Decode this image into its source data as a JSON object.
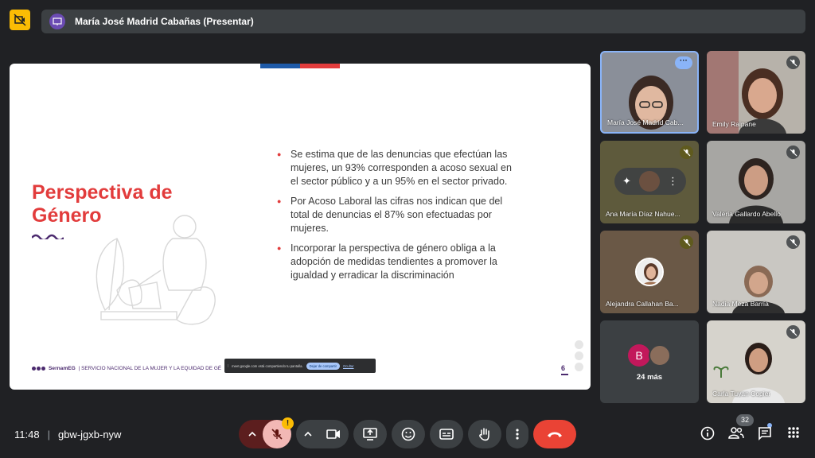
{
  "presenter": {
    "name": "María José Madrid Cabañas (Presentar)"
  },
  "slide": {
    "title": "Perspectiva de Género",
    "bullets": [
      "Se estima que de las denuncias que efectúan las mujeres, un 93% corresponden a acoso sexual en el sector público y a un 95% en el sector privado.",
      "Por Acoso Laboral las cifras nos indican que del total de denuncias el 87% son efectuadas por mujeres.",
      "Incorporar la perspectiva de género obliga a la adopción de medidas tendientes a promover la igualdad y erradicar la discriminación"
    ],
    "footer_brand": "SernamEG",
    "footer_text": "| SERVICIO NACIONAL DE LA MUJER Y LA EQUIDAD DE GÉ",
    "page_number": "6",
    "share_notice": "meet.google.com está compartiendo tu pantalla.",
    "stop_sharing": "Dejar de compartir",
    "hide": "Ocultar",
    "colors": {
      "title": "#e23c3c",
      "brand": "#4b2a6e"
    }
  },
  "participants": [
    {
      "name": "María José Madrid Cab...",
      "state": "active"
    },
    {
      "name": "Emily Raipane",
      "state": "muted"
    },
    {
      "name": "Ana María Díaz Nahue...",
      "state": "muted"
    },
    {
      "name": "Valeria Gallardo Abello",
      "state": "muted"
    },
    {
      "name": "Alejandra Callahan Ba...",
      "state": "muted"
    },
    {
      "name": "Nadia Meza Barría",
      "state": "muted"
    },
    {
      "name": "Carla Tuyan Copier",
      "state": "muted"
    }
  ],
  "more_tile": {
    "initial": "B",
    "label": "24 más"
  },
  "bottom_bar": {
    "time": "11:48",
    "separator": "|",
    "meeting_code": "gbw-jgxb-nyw",
    "warning_badge": "!",
    "participant_count": "32"
  }
}
